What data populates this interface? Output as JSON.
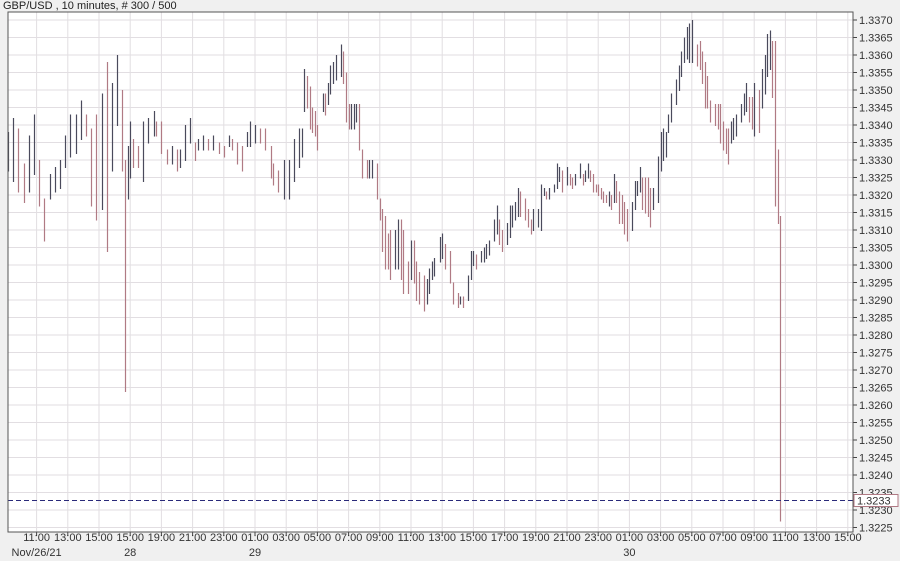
{
  "chart_data": {
    "type": "ohlc",
    "title": "GBP/USD , 10 minutes, # 300 / 500",
    "symbol": "GBP/USD",
    "interval": "10 minutes",
    "ylim": [
      1.3225,
      1.337
    ],
    "ystep": 0.0005,
    "grid": true,
    "current_price": 1.3233,
    "current_price_label": "1.3233",
    "colors": {
      "up": "#4a4a5c",
      "down": "#b07a84",
      "current_line": "#2a2a7a",
      "grid": "#e2dee2"
    },
    "x_ticks": [
      "11:00",
      "13:00",
      "15:00",
      "15:00",
      "19:00",
      "21:00",
      "23:00",
      "01:00",
      "03:00",
      "05:00",
      "07:00",
      "09:00",
      "11:00",
      "13:00",
      "15:00",
      "17:00",
      "19:00",
      "21:00",
      "23:00",
      "01:00",
      "03:00",
      "05:00",
      "07:00",
      "09:00",
      "11:00",
      "13:00",
      "15:00"
    ],
    "date_labels": [
      {
        "text": "Nov/26/21",
        "tick_index": 0
      },
      {
        "text": "28",
        "tick_index": 3
      },
      {
        "text": "29",
        "tick_index": 7
      },
      {
        "text": "30",
        "tick_index": 19
      }
    ],
    "bars_format": [
      "bar_index",
      "high",
      "low"
    ],
    "bars": [
      [
        0,
        1.3338,
        1.3327
      ],
      [
        2,
        1.3342,
        1.3324
      ],
      [
        4,
        1.3339,
        1.3321
      ],
      [
        6,
        1.3329,
        1.3318
      ],
      [
        8,
        1.3337,
        1.3321
      ],
      [
        10,
        1.3343,
        1.3326
      ],
      [
        12,
        1.333,
        1.3317
      ],
      [
        14,
        1.3319,
        1.3307
      ],
      [
        16,
        1.3326,
        1.3319
      ],
      [
        18,
        1.3328,
        1.3321
      ],
      [
        20,
        1.333,
        1.3322
      ],
      [
        22,
        1.3337,
        1.3328
      ],
      [
        24,
        1.3343,
        1.3331
      ],
      [
        26,
        1.3343,
        1.3332
      ],
      [
        28,
        1.3347,
        1.3336
      ],
      [
        30,
        1.3343,
        1.3337
      ],
      [
        32,
        1.3339,
        1.3317
      ],
      [
        34,
        1.3343,
        1.3313
      ],
      [
        36,
        1.3349,
        1.3316
      ],
      [
        38,
        1.3358,
        1.3304
      ],
      [
        40,
        1.3352,
        1.3327
      ],
      [
        42,
        1.336,
        1.334
      ],
      [
        44,
        1.335,
        1.3327
      ],
      [
        45,
        1.333,
        1.3264
      ],
      [
        46,
        1.3334,
        1.3319
      ],
      [
        47,
        1.3341,
        1.3325
      ],
      [
        48,
        1.3336,
        1.3328
      ],
      [
        50,
        1.3334,
        1.3328
      ],
      [
        52,
        1.3341,
        1.3324
      ],
      [
        54,
        1.3342,
        1.3335
      ],
      [
        56,
        1.3344,
        1.3337
      ],
      [
        57,
        1.3341,
        1.3337
      ],
      [
        59,
        1.3341,
        1.3332
      ],
      [
        61,
        1.3333,
        1.3329
      ],
      [
        63,
        1.3334,
        1.3329
      ],
      [
        65,
        1.3333,
        1.3327
      ],
      [
        66,
        1.3333,
        1.3328
      ],
      [
        68,
        1.334,
        1.333
      ],
      [
        70,
        1.3342,
        1.3335
      ],
      [
        72,
        1.3335,
        1.333
      ],
      [
        73,
        1.3336,
        1.3333
      ],
      [
        75,
        1.3337,
        1.3333
      ],
      [
        77,
        1.3336,
        1.3333
      ],
      [
        79,
        1.3337,
        1.3333
      ],
      [
        81,
        1.3335,
        1.3332
      ],
      [
        83,
        1.3334,
        1.3331
      ],
      [
        85,
        1.3337,
        1.3334
      ],
      [
        86,
        1.3336,
        1.3333
      ],
      [
        88,
        1.3335,
        1.3329
      ],
      [
        90,
        1.3334,
        1.3327
      ],
      [
        92,
        1.3338,
        1.3334
      ],
      [
        93,
        1.3341,
        1.3334
      ],
      [
        95,
        1.334,
        1.3335
      ],
      [
        97,
        1.3339,
        1.3335
      ],
      [
        99,
        1.3339,
        1.3333
      ],
      [
        101,
        1.3334,
        1.3325
      ],
      [
        102,
        1.3329,
        1.3323
      ],
      [
        104,
        1.3327,
        1.3321
      ],
      [
        106,
        1.333,
        1.3319
      ],
      [
        108,
        1.333,
        1.3319
      ],
      [
        110,
        1.3336,
        1.3324
      ],
      [
        112,
        1.3339,
        1.3328
      ],
      [
        113,
        1.3339,
        1.3331
      ],
      [
        114,
        1.3356,
        1.3344
      ],
      [
        115,
        1.3354,
        1.3345
      ],
      [
        116,
        1.3351,
        1.3339
      ],
      [
        117,
        1.3345,
        1.3338
      ],
      [
        118,
        1.3344,
        1.3337
      ],
      [
        119,
        1.334,
        1.3333
      ],
      [
        121,
        1.3349,
        1.3344
      ],
      [
        122,
        1.3349,
        1.3343
      ],
      [
        123,
        1.3352,
        1.3346
      ],
      [
        124,
        1.3357,
        1.3349
      ],
      [
        125,
        1.3358,
        1.3352
      ],
      [
        126,
        1.336,
        1.3353
      ],
      [
        128,
        1.3363,
        1.3354
      ],
      [
        129,
        1.3361,
        1.3352
      ],
      [
        130,
        1.3355,
        1.3341
      ],
      [
        131,
        1.3346,
        1.3339
      ],
      [
        132,
        1.3346,
        1.3339
      ],
      [
        133,
        1.3346,
        1.3339
      ],
      [
        134,
        1.3346,
        1.3341
      ],
      [
        135,
        1.3346,
        1.3333
      ],
      [
        136,
        1.3333,
        1.3325
      ],
      [
        138,
        1.333,
        1.3325
      ],
      [
        139,
        1.333,
        1.3325
      ],
      [
        140,
        1.333,
        1.3325
      ],
      [
        142,
        1.3329,
        1.3319
      ],
      [
        143,
        1.3319,
        1.3313
      ],
      [
        144,
        1.3316,
        1.3304
      ],
      [
        145,
        1.3314,
        1.3299
      ],
      [
        146,
        1.3309,
        1.3299
      ],
      [
        147,
        1.331,
        1.3296
      ],
      [
        149,
        1.331,
        1.3299
      ],
      [
        150,
        1.3313,
        1.3299
      ],
      [
        151,
        1.3313,
        1.3296
      ],
      [
        152,
        1.331,
        1.3292
      ],
      [
        154,
        1.3301,
        1.3292
      ],
      [
        155,
        1.3307,
        1.3296
      ],
      [
        156,
        1.3307,
        1.3295
      ],
      [
        157,
        1.3301,
        1.329
      ],
      [
        158,
        1.3298,
        1.3289
      ],
      [
        160,
        1.3297,
        1.3287
      ],
      [
        161,
        1.3296,
        1.3289
      ],
      [
        162,
        1.3299,
        1.3292
      ],
      [
        163,
        1.3301,
        1.3296
      ],
      [
        164,
        1.3302,
        1.3297
      ],
      [
        166,
        1.3308,
        1.3301
      ],
      [
        167,
        1.3309,
        1.3302
      ],
      [
        168,
        1.3306,
        1.3299
      ],
      [
        170,
        1.3304,
        1.3295
      ],
      [
        171,
        1.3295,
        1.3289
      ],
      [
        173,
        1.3292,
        1.3288
      ],
      [
        174,
        1.3291,
        1.3289
      ],
      [
        175,
        1.3291,
        1.3288
      ],
      [
        177,
        1.3297,
        1.329
      ],
      [
        178,
        1.3304,
        1.3296
      ],
      [
        179,
        1.3304,
        1.33
      ],
      [
        180,
        1.3303,
        1.3299
      ],
      [
        182,
        1.3304,
        1.3301
      ],
      [
        183,
        1.3305,
        1.3301
      ],
      [
        184,
        1.3306,
        1.3302
      ],
      [
        185,
        1.3307,
        1.3303
      ],
      [
        187,
        1.3313,
        1.3307
      ],
      [
        188,
        1.3317,
        1.3309
      ],
      [
        189,
        1.3313,
        1.3306
      ],
      [
        190,
        1.331,
        1.3304
      ],
      [
        192,
        1.3312,
        1.3306
      ],
      [
        193,
        1.3317,
        1.3308
      ],
      [
        194,
        1.3317,
        1.3311
      ],
      [
        195,
        1.3318,
        1.3313
      ],
      [
        196,
        1.3322,
        1.3314
      ],
      [
        197,
        1.3321,
        1.3314
      ],
      [
        199,
        1.3319,
        1.3313
      ],
      [
        200,
        1.3316,
        1.3311
      ],
      [
        201,
        1.3313,
        1.3309
      ],
      [
        202,
        1.3316,
        1.331
      ],
      [
        204,
        1.3316,
        1.3311
      ],
      [
        205,
        1.3323,
        1.331
      ],
      [
        206,
        1.3322,
        1.332
      ],
      [
        207,
        1.3321,
        1.3319
      ],
      [
        208,
        1.3322,
        1.3319
      ],
      [
        210,
        1.3323,
        1.3321
      ],
      [
        211,
        1.3329,
        1.3322
      ],
      [
        212,
        1.3328,
        1.3324
      ],
      [
        213,
        1.3327,
        1.3321
      ],
      [
        215,
        1.3328,
        1.3323
      ],
      [
        216,
        1.3326,
        1.3323
      ],
      [
        217,
        1.3325,
        1.3322
      ],
      [
        218,
        1.3326,
        1.3323
      ],
      [
        220,
        1.3329,
        1.3325
      ],
      [
        221,
        1.3326,
        1.3323
      ],
      [
        222,
        1.3327,
        1.3324
      ],
      [
        223,
        1.3329,
        1.3325
      ],
      [
        224,
        1.3327,
        1.3324
      ],
      [
        225,
        1.3326,
        1.3321
      ],
      [
        226,
        1.3323,
        1.3321
      ],
      [
        227,
        1.3323,
        1.332
      ],
      [
        228,
        1.3322,
        1.3319
      ],
      [
        229,
        1.3321,
        1.3318
      ],
      [
        230,
        1.332,
        1.3318
      ],
      [
        231,
        1.3321,
        1.3317
      ],
      [
        232,
        1.332,
        1.3316
      ],
      [
        233,
        1.3326,
        1.3318
      ],
      [
        234,
        1.3324,
        1.3318
      ],
      [
        235,
        1.3321,
        1.3312
      ],
      [
        236,
        1.332,
        1.3312
      ],
      [
        237,
        1.3318,
        1.3309
      ],
      [
        238,
        1.3316,
        1.3307
      ],
      [
        240,
        1.3318,
        1.331
      ],
      [
        241,
        1.3324,
        1.3316
      ],
      [
        242,
        1.3324,
        1.332
      ],
      [
        243,
        1.3328,
        1.3321
      ],
      [
        244,
        1.3325,
        1.3316
      ],
      [
        245,
        1.3325,
        1.3315
      ],
      [
        246,
        1.3325,
        1.3314
      ],
      [
        247,
        1.3322,
        1.3311
      ],
      [
        248,
        1.3322,
        1.3316
      ],
      [
        250,
        1.3331,
        1.3318
      ],
      [
        251,
        1.3338,
        1.3327
      ],
      [
        252,
        1.3339,
        1.333
      ],
      [
        253,
        1.3338,
        1.3331
      ],
      [
        254,
        1.3343,
        1.3338
      ],
      [
        255,
        1.3349,
        1.3341
      ],
      [
        257,
        1.3353,
        1.3346
      ],
      [
        258,
        1.3357,
        1.335
      ],
      [
        259,
        1.3361,
        1.3354
      ],
      [
        260,
        1.3365,
        1.3358
      ],
      [
        261,
        1.3368,
        1.3359
      ],
      [
        262,
        1.3369,
        1.3358
      ],
      [
        263,
        1.337,
        1.3358
      ],
      [
        265,
        1.3363,
        1.3357
      ],
      [
        266,
        1.3364,
        1.3356
      ],
      [
        267,
        1.3361,
        1.3352
      ],
      [
        268,
        1.3358,
        1.3345
      ],
      [
        269,
        1.3354,
        1.3345
      ],
      [
        270,
        1.3347,
        1.3341
      ],
      [
        272,
        1.3346,
        1.334
      ],
      [
        273,
        1.3346,
        1.3339
      ],
      [
        274,
        1.3346,
        1.3335
      ],
      [
        275,
        1.3341,
        1.3333
      ],
      [
        276,
        1.3339,
        1.3332
      ],
      [
        277,
        1.3339,
        1.3329
      ],
      [
        278,
        1.3341,
        1.3335
      ],
      [
        279,
        1.3342,
        1.3336
      ],
      [
        280,
        1.3343,
        1.3337
      ],
      [
        282,
        1.3346,
        1.3341
      ],
      [
        283,
        1.3349,
        1.3343
      ],
      [
        284,
        1.3352,
        1.3344
      ],
      [
        285,
        1.3348,
        1.3341
      ],
      [
        286,
        1.3348,
        1.3339
      ],
      [
        287,
        1.3352,
        1.3337
      ],
      [
        289,
        1.335,
        1.3338
      ],
      [
        290,
        1.3356,
        1.3345
      ],
      [
        291,
        1.336,
        1.3349
      ],
      [
        292,
        1.3366,
        1.3354
      ],
      [
        293,
        1.3367,
        1.3356
      ],
      [
        294,
        1.3364,
        1.3348
      ],
      [
        295,
        1.3364,
        1.3317
      ],
      [
        296,
        1.3333,
        1.3312
      ],
      [
        297,
        1.3314,
        1.3227
      ]
    ]
  }
}
